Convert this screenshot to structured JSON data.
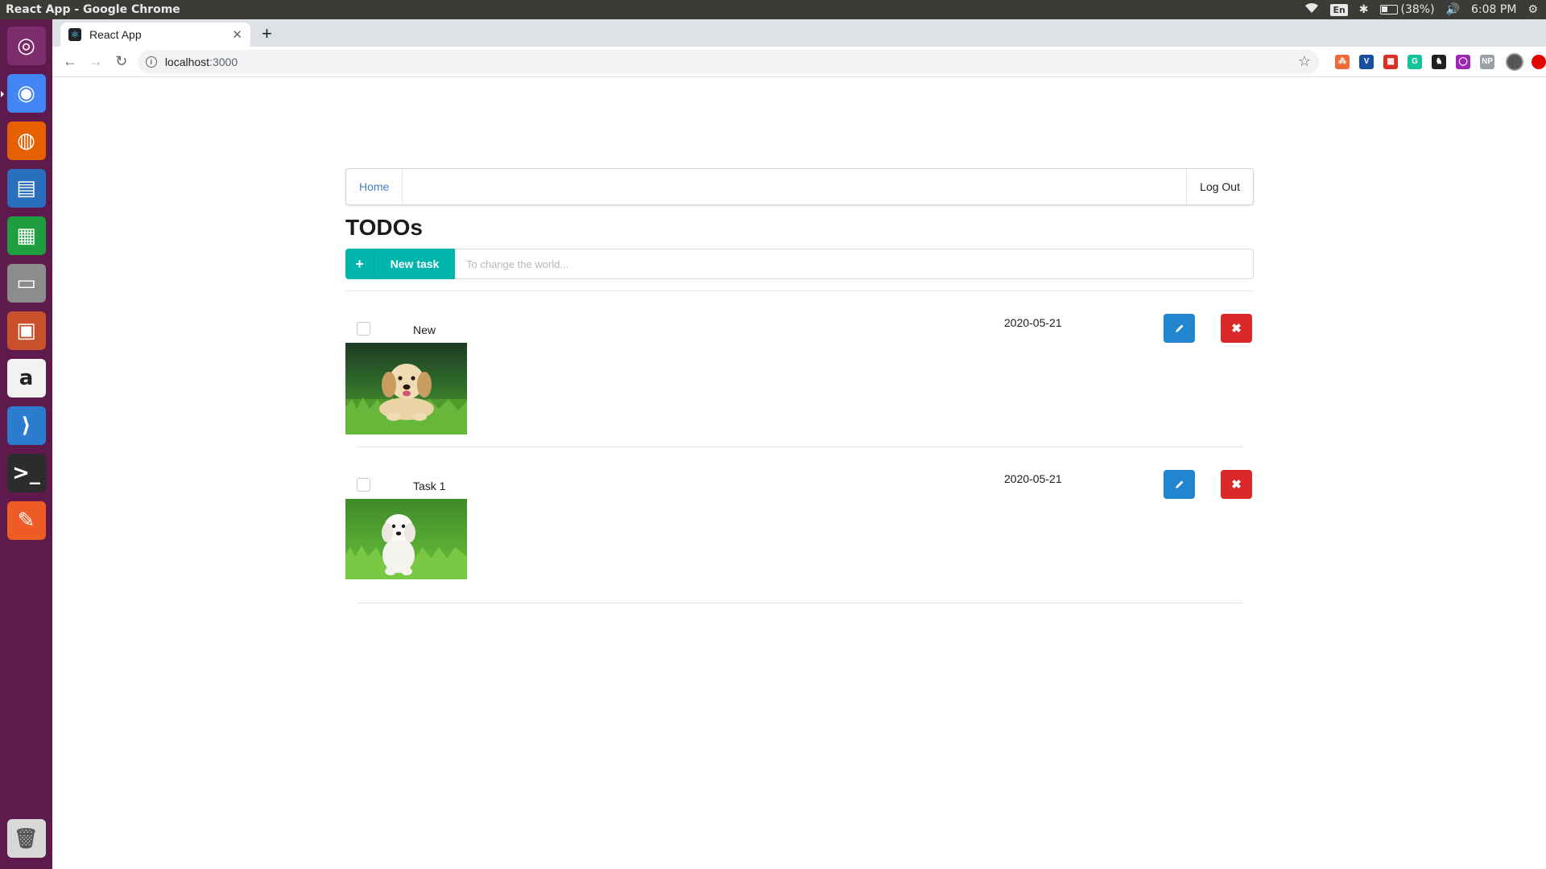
{
  "system": {
    "window_title": "React App - Google Chrome",
    "keyboard": "En",
    "battery": "(38%)",
    "battery_level": 0.38,
    "clock": "6:08 PM"
  },
  "launcher": {
    "items": [
      {
        "name": "ubuntu-dash",
        "color": "#7d2d6b",
        "glyph": "◎"
      },
      {
        "name": "chrome",
        "color": "#4285f4",
        "glyph": "◉",
        "active": true
      },
      {
        "name": "firefox",
        "color": "#e66000",
        "glyph": "◍"
      },
      {
        "name": "writer",
        "color": "#2a6fbd",
        "glyph": "▤"
      },
      {
        "name": "calc",
        "color": "#1e9e3e",
        "glyph": "▦"
      },
      {
        "name": "files",
        "color": "#8c8c8c",
        "glyph": "▭"
      },
      {
        "name": "impress",
        "color": "#c8502a",
        "glyph": "▣"
      },
      {
        "name": "amazon",
        "color": "#f2f2f2",
        "glyph": "a"
      },
      {
        "name": "vscode",
        "color": "#2b7ccf",
        "glyph": "⟩"
      },
      {
        "name": "terminal",
        "color": "#2c2c2c",
        "glyph": ">_"
      },
      {
        "name": "postman",
        "color": "#ef5b25",
        "glyph": "✎"
      }
    ],
    "trash_glyph": "🗑"
  },
  "browser": {
    "tab_title": "React App",
    "tab_favicon": "⚛",
    "address_host": "localhost",
    "address_port": ":3000",
    "extensions": [
      {
        "name": "ext-1",
        "color": "#f06a35",
        "label": "⁂"
      },
      {
        "name": "ext-2",
        "color": "#1a4fa0",
        "label": "V"
      },
      {
        "name": "ext-3",
        "color": "#d93025",
        "label": "▦"
      },
      {
        "name": "ext-4",
        "color": "#15c39a",
        "label": "G"
      },
      {
        "name": "ext-5",
        "color": "#202124",
        "label": "♞"
      },
      {
        "name": "ext-6",
        "color": "#9c27b0",
        "label": "◯"
      },
      {
        "name": "ext-7",
        "color": "#9aa0a6",
        "label": "NP"
      }
    ]
  },
  "app": {
    "nav": {
      "home": "Home",
      "logout": "Log Out"
    },
    "title": "TODOs",
    "new_task": {
      "label": "New task",
      "placeholder": "To change the world..."
    },
    "tasks": [
      {
        "name": "New",
        "date": "2020-05-21",
        "checked": false
      },
      {
        "name": "Task 1",
        "date": "2020-05-21",
        "checked": false
      }
    ]
  },
  "colors": {
    "teal": "#00b5ad",
    "edit_blue": "#2185d0",
    "delete_red": "#db2828",
    "link_blue": "#4183c4"
  }
}
